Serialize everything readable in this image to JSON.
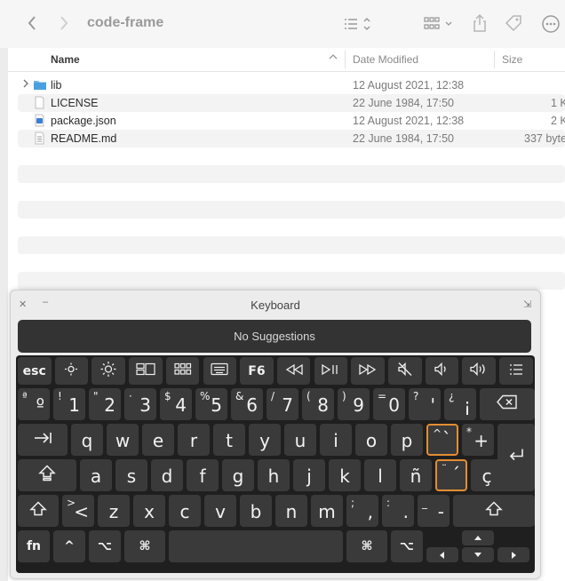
{
  "window": {
    "title": "code-frame",
    "toolbar_icons": [
      "back-icon",
      "forward-icon",
      "list-view-icon",
      "group-icon",
      "share-icon",
      "tag-icon",
      "more-icon"
    ]
  },
  "list": {
    "headers": {
      "name": "Name",
      "date": "Date Modified",
      "size": "Size"
    },
    "rows": [
      {
        "name": "lib",
        "date": "12 August 2021, 12:38",
        "size": "",
        "type": "folder"
      },
      {
        "name": "LICENSE",
        "date": "22 June 1984, 17:50",
        "size": "1 K",
        "type": "file"
      },
      {
        "name": "package.json",
        "date": "12 August 2021, 12:38",
        "size": "2 K",
        "type": "json"
      },
      {
        "name": "README.md",
        "date": "22 June 1984, 17:50",
        "size": "337 byte",
        "type": "md"
      }
    ]
  },
  "keyboard": {
    "title": "Keyboard",
    "suggestion": "No Suggestions",
    "fn_row": [
      {
        "label": "esc",
        "icon": ""
      },
      {
        "label": "",
        "icon": "brightness-down-icon"
      },
      {
        "label": "",
        "icon": "brightness-up-icon"
      },
      {
        "label": "",
        "icon": "mission-control-icon"
      },
      {
        "label": "",
        "icon": "launchpad-icon"
      },
      {
        "label": "",
        "icon": "keyboard-backlight-icon"
      },
      {
        "label": "F6",
        "icon": ""
      },
      {
        "label": "",
        "icon": "rewind-icon"
      },
      {
        "label": "",
        "icon": "play-pause-icon"
      },
      {
        "label": "",
        "icon": "fast-forward-icon"
      },
      {
        "label": "",
        "icon": "mute-icon"
      },
      {
        "label": "",
        "icon": "volume-down-icon"
      },
      {
        "label": "",
        "icon": "volume-up-icon"
      },
      {
        "label": "",
        "icon": "menu-icon"
      }
    ],
    "number_row": [
      {
        "main": "º",
        "shift": "ª"
      },
      {
        "main": "1",
        "shift": "!"
      },
      {
        "main": "2",
        "shift": "\""
      },
      {
        "main": "3",
        "shift": "·"
      },
      {
        "main": "4",
        "shift": "$"
      },
      {
        "main": "5",
        "shift": "%"
      },
      {
        "main": "6",
        "shift": "&"
      },
      {
        "main": "7",
        "shift": "/"
      },
      {
        "main": "8",
        "shift": "("
      },
      {
        "main": "9",
        "shift": ")"
      },
      {
        "main": "0",
        "shift": "="
      },
      {
        "main": "'",
        "shift": "?"
      },
      {
        "main": "¡",
        "shift": "¿"
      }
    ],
    "row_q": [
      "q",
      "w",
      "e",
      "r",
      "t",
      "y",
      "u",
      "i",
      "o",
      "p"
    ],
    "row_q_extra": [
      {
        "main": "`",
        "shift": "^",
        "highlight": true
      },
      {
        "main": "+",
        "shift": "*",
        "highlight": false
      }
    ],
    "row_a": [
      "a",
      "s",
      "d",
      "f",
      "g",
      "h",
      "j",
      "k",
      "l",
      "ñ"
    ],
    "row_a_extra": [
      {
        "main": "´",
        "shift": "¨",
        "highlight": true
      },
      {
        "main": "ç",
        "shift": "",
        "highlight": false
      }
    ],
    "row_z": [
      {
        "main": "<",
        "shift": ">"
      },
      {
        "main": "z",
        "shift": ""
      },
      {
        "main": "x",
        "shift": ""
      },
      {
        "main": "c",
        "shift": ""
      },
      {
        "main": "v",
        "shift": ""
      },
      {
        "main": "b",
        "shift": ""
      },
      {
        "main": "n",
        "shift": ""
      },
      {
        "main": "m",
        "shift": ""
      },
      {
        "main": ",",
        "shift": ";"
      },
      {
        "main": ".",
        "shift": ":"
      },
      {
        "main": "-",
        "shift": "_"
      }
    ],
    "bottom": {
      "fn": "fn",
      "ctrl": "^",
      "option": "⌥",
      "command": "⌘"
    },
    "accent_color": "#e38d33"
  }
}
